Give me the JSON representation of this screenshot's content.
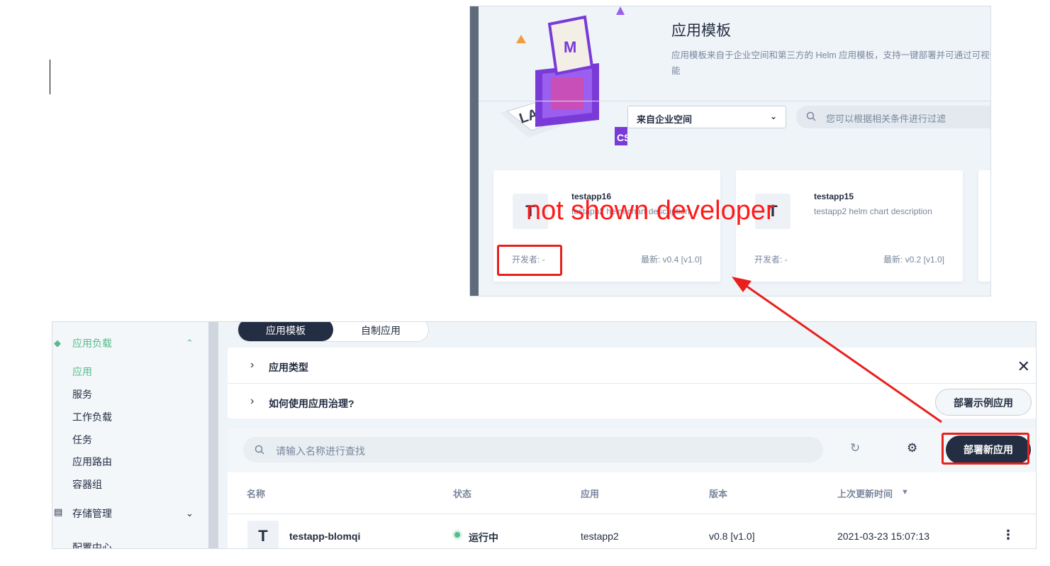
{
  "annotation": {
    "note": "not shown developer",
    "accent_color": "#e8201c"
  },
  "templates": {
    "title": "应用模板",
    "description": "应用模板来自于企业空间和第三方的 Helm 应用模板，支持一键部署并可通过可视化",
    "description_cont": "能",
    "source_select": "来自企业空间",
    "filter_placeholder": "您可以根据相关条件进行过滤",
    "cards": [
      {
        "logo": "T",
        "name": "testapp16",
        "description": "testapp2 helm chart description",
        "developer": "开发者: -",
        "latest": "最新: v0.4 [v1.0]"
      },
      {
        "logo": "T",
        "name": "testapp15",
        "description": "testapp2 helm chart description",
        "developer": "开发者: -",
        "latest": "最新: v0.2 [v1.0]"
      }
    ]
  },
  "workloads": {
    "sidebar": {
      "group_app": "应用负载",
      "items": [
        "应用",
        "服务",
        "工作负载",
        "任务",
        "应用路由",
        "容器组"
      ],
      "group_storage": "存储管理",
      "group_config": "配置中心"
    },
    "tabs": [
      "应用模板",
      "自制应用"
    ],
    "collapse": {
      "app_type": "应用类型",
      "how_to": "如何使用应用治理?"
    },
    "demo_button": "部署示例应用",
    "search_placeholder": "请输入名称进行查找",
    "deploy_button": "部署新应用",
    "table": {
      "headers": [
        "名称",
        "状态",
        "应用",
        "版本",
        "上次更新时间"
      ],
      "rows": [
        {
          "logo": "T",
          "name": "testapp-blomqi",
          "status": "运行中",
          "app": "testapp2",
          "version": "v0.8 [v1.0]",
          "updated": "2021-03-23 15:07:13"
        }
      ]
    },
    "status_color": "#55bc8a"
  }
}
